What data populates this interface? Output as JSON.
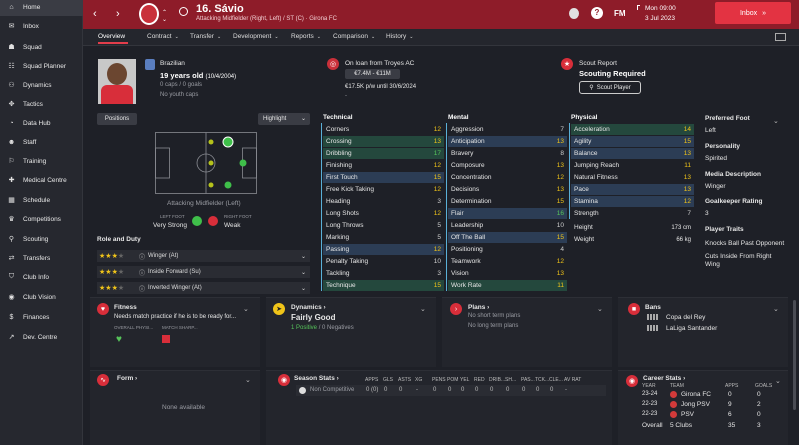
{
  "sidebar": {
    "items": [
      {
        "icon": "home-icon",
        "glyph": "⌂",
        "label": "Home"
      },
      {
        "icon": "inbox-icon",
        "glyph": "✉",
        "label": "Inbox",
        "badge": "4"
      },
      {
        "icon": "squad-icon",
        "glyph": "☗",
        "label": "Squad"
      },
      {
        "icon": "squad-planner-icon",
        "glyph": "☷",
        "label": "Squad Planner"
      },
      {
        "icon": "dynamics-icon",
        "glyph": "⚇",
        "label": "Dynamics"
      },
      {
        "icon": "tactics-icon",
        "glyph": "✥",
        "label": "Tactics"
      },
      {
        "icon": "data-hub-icon",
        "glyph": "◔",
        "label": "Data Hub"
      },
      {
        "icon": "staff-icon",
        "glyph": "☻",
        "label": "Staff"
      },
      {
        "icon": "training-icon",
        "glyph": "⚐",
        "label": "Training"
      },
      {
        "icon": "medical-icon",
        "glyph": "✚",
        "label": "Medical Centre"
      },
      {
        "icon": "schedule-icon",
        "glyph": "▦",
        "label": "Schedule"
      },
      {
        "icon": "competitions-icon",
        "glyph": "♛",
        "label": "Competitions"
      },
      {
        "icon": "scouting-icon",
        "glyph": "⚲",
        "label": "Scouting"
      },
      {
        "icon": "transfers-icon",
        "glyph": "⇄",
        "label": "Transfers"
      },
      {
        "icon": "club-info-icon",
        "glyph": "⛉",
        "label": "Club Info"
      },
      {
        "icon": "club-vision-icon",
        "glyph": "◉",
        "label": "Club Vision"
      },
      {
        "icon": "finances-icon",
        "glyph": "$",
        "label": "Finances"
      },
      {
        "icon": "dev-centre-icon",
        "glyph": "↗",
        "label": "Dev. Centre"
      }
    ]
  },
  "header": {
    "player_name": "16. Sávio",
    "player_desc": "Attacking Midfielder (Right, Left) / ST (C) · Girona FC",
    "date_day": "Mon 09:00",
    "date": "3 Jul 2023",
    "inbox_label": "Inbox",
    "fm_label": "FM",
    "help_label": "?"
  },
  "tabs": [
    {
      "label": "Overview",
      "active": true
    },
    {
      "label": "Contract"
    },
    {
      "label": "Transfer"
    },
    {
      "label": "Development"
    },
    {
      "label": "Reports"
    },
    {
      "label": "Comparison"
    },
    {
      "label": "History"
    }
  ],
  "info": {
    "nationality": "Brazilian",
    "age": "19 years old",
    "dob": "(10/4/2004)",
    "caps": "0 caps / 0 goals",
    "youth_caps": "No youth caps"
  },
  "loan": {
    "title": "On loan from Troyes AC",
    "value_range": "€7.4M - €11M",
    "wage": "€17.5K p/w until 30/6/2024",
    "dash": "-"
  },
  "scout": {
    "title": "Scout Report",
    "status": "Scouting Required",
    "button": "Scout Player"
  },
  "positions": {
    "button": "Positions",
    "highlight": "Highlight",
    "position_name": "Attacking Midfielder (Left)",
    "left_foot_label": "LEFT FOOT",
    "left_foot_value": "Very Strong",
    "right_foot_label": "RIGHT FOOT",
    "right_foot_value": "Weak"
  },
  "role_duty": {
    "title": "Role and Duty",
    "roles": [
      {
        "stars": 3,
        "name": "Winger (At)"
      },
      {
        "stars": 3,
        "name": "Inside Forward (Su)"
      },
      {
        "stars": 3,
        "name": "Inverted Winger (At)"
      }
    ]
  },
  "technical": {
    "title": "Technical",
    "attrs": [
      {
        "name": "Corners",
        "value": "12",
        "hl": ""
      },
      {
        "name": "Crossing",
        "value": "13",
        "hl": "green"
      },
      {
        "name": "Dribbling",
        "value": "17",
        "hl": "green"
      },
      {
        "name": "Finishing",
        "value": "12",
        "hl": ""
      },
      {
        "name": "First Touch",
        "value": "15",
        "hl": "blue"
      },
      {
        "name": "Free Kick Taking",
        "value": "12",
        "hl": ""
      },
      {
        "name": "Heading",
        "value": "3",
        "hl": ""
      },
      {
        "name": "Long Shots",
        "value": "12",
        "hl": ""
      },
      {
        "name": "Long Throws",
        "value": "5",
        "hl": ""
      },
      {
        "name": "Marking",
        "value": "5",
        "hl": ""
      },
      {
        "name": "Passing",
        "value": "12",
        "hl": "blue"
      },
      {
        "name": "Penalty Taking",
        "value": "10",
        "hl": ""
      },
      {
        "name": "Tackling",
        "value": "3",
        "hl": ""
      },
      {
        "name": "Technique",
        "value": "15",
        "hl": "green"
      }
    ]
  },
  "mental": {
    "title": "Mental",
    "attrs": [
      {
        "name": "Aggression",
        "value": "7",
        "hl": ""
      },
      {
        "name": "Anticipation",
        "value": "13",
        "hl": "blue"
      },
      {
        "name": "Bravery",
        "value": "8",
        "hl": ""
      },
      {
        "name": "Composure",
        "value": "13",
        "hl": ""
      },
      {
        "name": "Concentration",
        "value": "12",
        "hl": ""
      },
      {
        "name": "Decisions",
        "value": "13",
        "hl": ""
      },
      {
        "name": "Determination",
        "value": "15",
        "hl": ""
      },
      {
        "name": "Flair",
        "value": "16",
        "hl": "blue"
      },
      {
        "name": "Leadership",
        "value": "10",
        "hl": ""
      },
      {
        "name": "Off The Ball",
        "value": "15",
        "hl": "blue"
      },
      {
        "name": "Positioning",
        "value": "4",
        "hl": ""
      },
      {
        "name": "Teamwork",
        "value": "12",
        "hl": ""
      },
      {
        "name": "Vision",
        "value": "13",
        "hl": ""
      },
      {
        "name": "Work Rate",
        "value": "11",
        "hl": "green"
      }
    ]
  },
  "physical": {
    "title": "Physical",
    "attrs": [
      {
        "name": "Acceleration",
        "value": "14",
        "hl": "green"
      },
      {
        "name": "Agility",
        "value": "15",
        "hl": "blue"
      },
      {
        "name": "Balance",
        "value": "13",
        "hl": "blue"
      },
      {
        "name": "Jumping Reach",
        "value": "11",
        "hl": ""
      },
      {
        "name": "Natural Fitness",
        "value": "13",
        "hl": ""
      },
      {
        "name": "Pace",
        "value": "13",
        "hl": "blue"
      },
      {
        "name": "Stamina",
        "value": "12",
        "hl": "blue"
      },
      {
        "name": "Strength",
        "value": "7",
        "hl": ""
      }
    ],
    "height_label": "Height",
    "height": "173 cm",
    "weight_label": "Weight",
    "weight": "66 kg"
  },
  "right_info": {
    "pref_foot_title": "Preferred Foot",
    "pref_foot": "Left",
    "personality_title": "Personality",
    "personality": "Spirited",
    "media_title": "Media Description",
    "media": "Winger",
    "gk_title": "Goalkeeper Rating",
    "gk": "3",
    "traits_title": "Player Traits",
    "traits": [
      "Knocks Ball Past Opponent",
      "Cuts Inside From Right Wing"
    ]
  },
  "fitness": {
    "title": "Fitness",
    "text": "Needs match practice if he is to be ready for...",
    "col1": "OVERALL PHYSI...",
    "col2": "MATCH SHARP..."
  },
  "dynamics": {
    "title": "Dynamics",
    "status": "Fairly Good",
    "positives": "1 Positive",
    "sep": "/",
    "negatives": "0 Negatives"
  },
  "plans": {
    "title": "Plans",
    "short": "No short term plans",
    "long": "No long term plans"
  },
  "bans": {
    "title": "Bans",
    "items": [
      "Copa del Rey",
      "LaLiga Santander"
    ]
  },
  "form": {
    "title": "Form",
    "empty": "None available"
  },
  "season": {
    "title": "Season Stats",
    "headers": [
      "APPS",
      "GLS",
      "ASTS",
      "XG",
      "PENS",
      "POM",
      "YEL",
      "RED",
      "DRIB...",
      "SH...",
      "PAS...",
      "TCK...",
      "CLE...",
      "AV RAT"
    ],
    "comp": "Non Competitive",
    "values": [
      "0 (0)",
      "0",
      "0",
      "-",
      "0",
      "0",
      "0",
      "0",
      "0",
      "0",
      "0",
      "0",
      "0",
      "-"
    ]
  },
  "career": {
    "title": "Career Stats",
    "headers": [
      "YEAR",
      "TEAM",
      "APPS",
      "GOALS"
    ],
    "rows": [
      {
        "year": "23-24",
        "team": "Girona FC",
        "apps": "0",
        "goals": "0",
        "color": "#d23a3a"
      },
      {
        "year": "22-23",
        "team": "Jong PSV",
        "apps": "9",
        "goals": "2",
        "color": "#d23a3a"
      },
      {
        "year": "22-23",
        "team": "PSV",
        "apps": "6",
        "goals": "0",
        "color": "#d23a3a"
      }
    ],
    "overall_label": "Overall",
    "overall_team": "5 Clubs",
    "overall_apps": "35",
    "overall_goals": "3"
  }
}
